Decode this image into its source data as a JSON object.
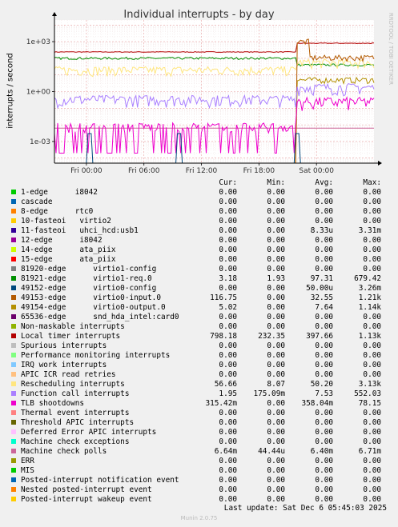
{
  "title": "Individual interrupts - by day",
  "side_label": "RRDTOOL / TOBI OETIKER",
  "footer": "Munin 2.0.75",
  "last_update": "Last update: Sat Dec  6 05:45:03 2025",
  "legend_headers": {
    "cur": "Cur:",
    "min": "Min:",
    "avg": "Avg:",
    "max": "Max:"
  },
  "chart_data": {
    "type": "line",
    "title": "Individual interrupts - by day",
    "ylabel": "interrupts / second",
    "yscale": "log",
    "ylim": [
      5e-05,
      20000
    ],
    "yticks": [
      {
        "v": 1000,
        "label": "1e+03"
      },
      {
        "v": 1,
        "label": "1e+00"
      },
      {
        "v": 0.001,
        "label": "1e-03"
      }
    ],
    "xticks": [
      "Fri 00:00",
      "Fri 06:00",
      "Fri 12:00",
      "Fri 18:00",
      "Sat 00:00"
    ],
    "grid": true,
    "series": [
      {
        "name": "1-edge      i8042",
        "color": "#00cc00",
        "cur": "0.00",
        "min": "0.00",
        "avg": "0.00",
        "max": "0.00"
      },
      {
        "name": "cascade",
        "color": "#0066b3",
        "cur": "0.00",
        "min": "0.00",
        "avg": "0.00",
        "max": "0.00"
      },
      {
        "name": "8-edge      rtc0",
        "color": "#ff8000",
        "cur": "0.00",
        "min": "0.00",
        "avg": "0.00",
        "max": "0.00"
      },
      {
        "name": "10-fasteoi   virtio2",
        "color": "#ffcc00",
        "cur": "0.00",
        "min": "0.00",
        "avg": "0.00",
        "max": "0.00"
      },
      {
        "name": "11-fasteoi   uhci_hcd:usb1",
        "color": "#330099",
        "cur": "0.00",
        "min": "0.00",
        "avg": "8.33u",
        "max": "3.31m"
      },
      {
        "name": "12-edge      i8042",
        "color": "#990099",
        "cur": "0.00",
        "min": "0.00",
        "avg": "0.00",
        "max": "0.00"
      },
      {
        "name": "14-edge      ata_piix",
        "color": "#ccff00",
        "cur": "0.00",
        "min": "0.00",
        "avg": "0.00",
        "max": "0.00"
      },
      {
        "name": "15-edge      ata_piix",
        "color": "#ff0000",
        "cur": "0.00",
        "min": "0.00",
        "avg": "0.00",
        "max": "0.00"
      },
      {
        "name": "81920-edge      virtio1-config",
        "color": "#808080",
        "cur": "0.00",
        "min": "0.00",
        "avg": "0.00",
        "max": "0.00"
      },
      {
        "name": "81921-edge      virtio1-req.0",
        "color": "#008f00",
        "cur": "3.18",
        "min": "1.93",
        "avg": "97.31",
        "max": "679.42"
      },
      {
        "name": "49152-edge      virtio0-config",
        "color": "#00487d",
        "cur": "0.00",
        "min": "0.00",
        "avg": "50.00u",
        "max": "3.26m"
      },
      {
        "name": "49153-edge      virtio0-input.0",
        "color": "#b35a00",
        "cur": "116.75",
        "min": "0.00",
        "avg": "32.55",
        "max": "1.21k"
      },
      {
        "name": "49154-edge      virtio0-output.0",
        "color": "#b38f00",
        "cur": "5.02",
        "min": "0.00",
        "avg": "7.64",
        "max": "1.14k"
      },
      {
        "name": "65536-edge      snd_hda_intel:card0",
        "color": "#6b006b",
        "cur": "0.00",
        "min": "0.00",
        "avg": "0.00",
        "max": "0.00"
      },
      {
        "name": "Non-maskable interrupts",
        "color": "#8fb300",
        "cur": "0.00",
        "min": "0.00",
        "avg": "0.00",
        "max": "0.00"
      },
      {
        "name": "Local timer interrupts",
        "color": "#b30000",
        "cur": "798.18",
        "min": "232.35",
        "avg": "397.66",
        "max": "1.13k"
      },
      {
        "name": "Spurious interrupts",
        "color": "#bebebe",
        "cur": "0.00",
        "min": "0.00",
        "avg": "0.00",
        "max": "0.00"
      },
      {
        "name": "Performance monitoring interrupts",
        "color": "#80ff80",
        "cur": "0.00",
        "min": "0.00",
        "avg": "0.00",
        "max": "0.00"
      },
      {
        "name": "IRQ work interrupts",
        "color": "#80c9ff",
        "cur": "0.00",
        "min": "0.00",
        "avg": "0.00",
        "max": "0.00"
      },
      {
        "name": "APIC ICR read retries",
        "color": "#ffc080",
        "cur": "0.00",
        "min": "0.00",
        "avg": "0.00",
        "max": "0.00"
      },
      {
        "name": "Rescheduling interrupts",
        "color": "#ffe680",
        "cur": "56.66",
        "min": "8.07",
        "avg": "50.20",
        "max": "3.13k"
      },
      {
        "name": "Function call interrupts",
        "color": "#aa80ff",
        "cur": "1.95",
        "min": "175.09m",
        "avg": "7.53",
        "max": "552.03"
      },
      {
        "name": "TLB shootdowns",
        "color": "#ee00cc",
        "cur": "315.42m",
        "min": "0.00",
        "avg": "358.04m",
        "max": "78.15"
      },
      {
        "name": "Thermal event interrupts",
        "color": "#ff8080",
        "cur": "0.00",
        "min": "0.00",
        "avg": "0.00",
        "max": "0.00"
      },
      {
        "name": "Threshold APIC interrupts",
        "color": "#666600",
        "cur": "0.00",
        "min": "0.00",
        "avg": "0.00",
        "max": "0.00"
      },
      {
        "name": "Deferred Error APIC interrupts",
        "color": "#ffbfff",
        "cur": "0.00",
        "min": "0.00",
        "avg": "0.00",
        "max": "0.00"
      },
      {
        "name": "Machine check exceptions",
        "color": "#00ffcc",
        "cur": "0.00",
        "min": "0.00",
        "avg": "0.00",
        "max": "0.00"
      },
      {
        "name": "Machine check polls",
        "color": "#cc6699",
        "cur": "6.64m",
        "min": "44.44u",
        "avg": "6.40m",
        "max": "6.71m"
      },
      {
        "name": "ERR",
        "color": "#999900",
        "cur": "0.00",
        "min": "0.00",
        "avg": "0.00",
        "max": "0.00"
      },
      {
        "name": "MIS",
        "color": "#00cc00",
        "cur": "0.00",
        "min": "0.00",
        "avg": "0.00",
        "max": "0.00"
      },
      {
        "name": "Posted-interrupt notification event",
        "color": "#0066b3",
        "cur": "0.00",
        "min": "0.00",
        "avg": "0.00",
        "max": "0.00"
      },
      {
        "name": "Nested posted-interrupt event",
        "color": "#ff8000",
        "cur": "0.00",
        "min": "0.00",
        "avg": "0.00",
        "max": "0.00"
      },
      {
        "name": "Posted-interrupt wakeup event",
        "color": "#ffcc00",
        "cur": "0.00",
        "min": "0.00",
        "avg": "0.00",
        "max": "0.00"
      }
    ]
  }
}
